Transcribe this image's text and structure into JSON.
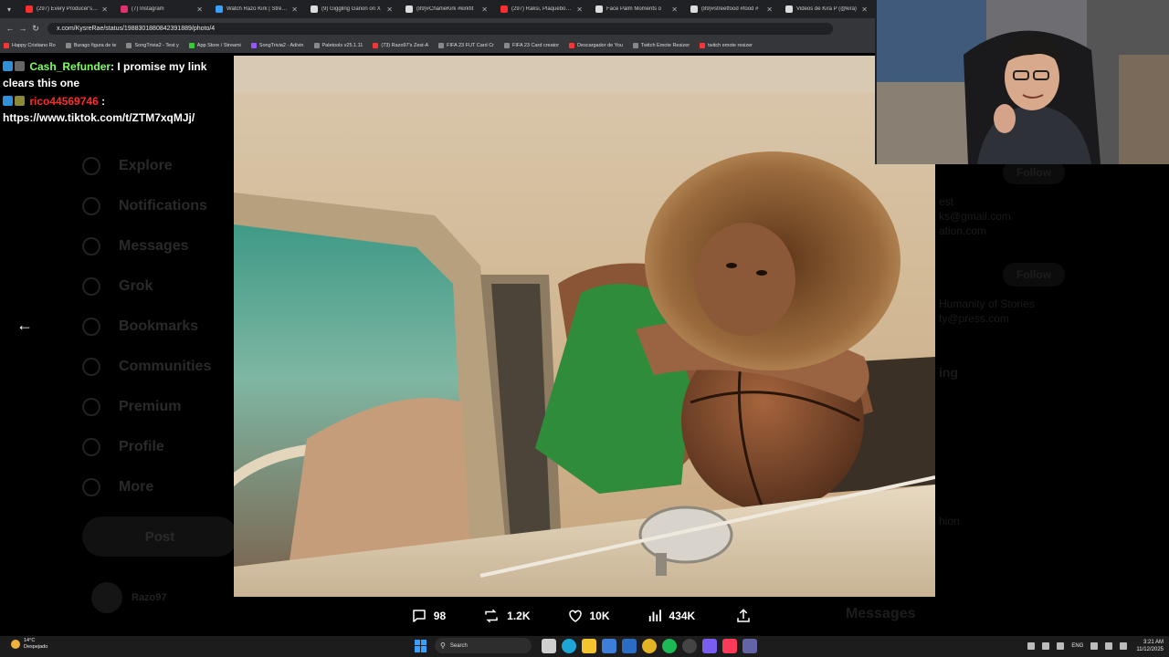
{
  "browser": {
    "tabs": [
      {
        "label": "(297) Every Producer's To",
        "color": "#ff2d2d"
      },
      {
        "label": "(7) Instagram",
        "color": "#e1306c"
      },
      {
        "label": "Watch Razo Kirk | Stream",
        "color": "#3aa0ff"
      },
      {
        "label": "(9) Giggling Ganon on X",
        "color": "#ffffff"
      },
      {
        "label": "(89)#CharlieKirk #kirkfit",
        "color": "#ffffff"
      },
      {
        "label": "(297) Raksi, Plaqueboyen",
        "color": "#ff2d2d"
      },
      {
        "label": "Face Palm Moments o",
        "color": "#ffffff"
      },
      {
        "label": "(89)#streetfood #food #",
        "color": "#ffffff"
      },
      {
        "label": "Videos de Kira P (@kira)",
        "color": "#ffffff"
      }
    ],
    "url": "x.com/KysreRae/status/1988301880842391889/photo/4",
    "bookmarks": [
      {
        "label": "Happy Cristiano Ro",
        "color": "#ff3333"
      },
      {
        "label": "Burago figura de te",
        "color": "#888888"
      },
      {
        "label": "SongTrivia2 - Test y",
        "color": "#888888"
      },
      {
        "label": "App Store / Streami",
        "color": "#33cc33"
      },
      {
        "label": "SongTrivia2 - Adivin",
        "color": "#9955ff"
      },
      {
        "label": "Paletools v25.1.11",
        "color": "#888888"
      },
      {
        "label": "(73) Razo97's Zest-A",
        "color": "#ff3333"
      },
      {
        "label": "FIFA 23 FUT Card Cr",
        "color": "#888888"
      },
      {
        "label": "FIFA 23 Card creator",
        "color": "#888888"
      },
      {
        "label": "Descargador de You",
        "color": "#ff3333"
      },
      {
        "label": "Twitch Emote Resizer",
        "color": "#888888"
      },
      {
        "label": "twitch emote resizer",
        "color": "#ff3333"
      }
    ]
  },
  "chat": {
    "messages": [
      {
        "user": "Cash_Refunder",
        "sep": ": ",
        "text": "I promise my link clears this one"
      },
      {
        "user": "rico44569746",
        "sep": " :",
        "text": "https://www.tiktok.com/t/ZTM7xqMJj/"
      }
    ]
  },
  "x_sidebar": {
    "items": [
      "Explore",
      "Notifications",
      "Messages",
      "Grok",
      "Bookmarks",
      "Communities",
      "Premium",
      "Profile",
      "More"
    ],
    "post_label": "Post",
    "profile_name": "Razo97"
  },
  "right_panel": {
    "follow_label": "Follow",
    "lines": [
      "est",
      "ks@gmail.com",
      "ation.com",
      "Humanity of Stories",
      "ty@press.com",
      "ing",
      "hion"
    ]
  },
  "actions": {
    "replies": "98",
    "reposts": "1.2K",
    "likes": "10K",
    "views": "434K",
    "messages_label": "Messages"
  },
  "taskbar": {
    "weather_temp": "14°C",
    "weather_desc": "Despejado",
    "search_placeholder": "Search",
    "lang": "ENG",
    "time": "3:21 AM",
    "date": "11/12/2025"
  },
  "colors": {
    "chat_user1": "#7cff5b",
    "chat_user2": "#ff2a2a",
    "accent_blue": "#3aa0ff"
  }
}
